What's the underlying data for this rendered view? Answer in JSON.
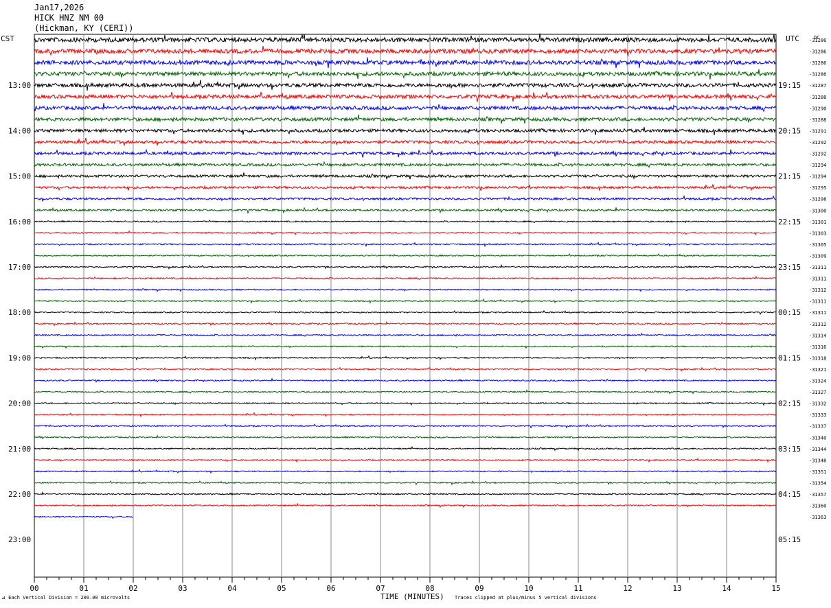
{
  "header": {
    "date": "Jan17,2026",
    "station": "HICK HNZ NM 00",
    "location": "(Hickman, KY (CERI))"
  },
  "left_tz": "CST",
  "right_tz": "UTC",
  "dc_label": "DC",
  "chart_data": {
    "type": "line",
    "title": "HICK HNZ NM 00",
    "xlabel": "TIME (MINUTES)",
    "x_ticks": [
      "00",
      "01",
      "02",
      "03",
      "04",
      "05",
      "06",
      "07",
      "08",
      "09",
      "10",
      "11",
      "12",
      "13",
      "14",
      "15"
    ],
    "xlim": [
      0,
      15
    ],
    "hour_labels_left": [
      "13:00",
      "14:00",
      "15:00",
      "16:00",
      "17:00",
      "18:00",
      "19:00",
      "20:00",
      "21:00",
      "22:00",
      "23:00"
    ],
    "hour_labels_right": [
      "19:15",
      "20:15",
      "21:15",
      "22:15",
      "23:15",
      "00:15",
      "01:15",
      "02:15",
      "03:15",
      "04:15",
      "05:15"
    ],
    "trace_colors": [
      "#000000",
      "#ff0000",
      "#0000ff",
      "#006400"
    ],
    "dc_offsets": [
      "-31286",
      "-31286",
      "-31286",
      "-31286",
      "-31287",
      "-31288",
      "-31290",
      "-31288",
      "-31291",
      "-31292",
      "-31292",
      "-31294",
      "-31294",
      "-31295",
      "-31298",
      "-31300",
      "-31301",
      "-31303",
      "-31305",
      "-31309",
      "-31311",
      "-31311",
      "-31312",
      "-31311",
      "-31311",
      "-31312",
      "-31314",
      "-31316",
      "-31318",
      "-31321",
      "-31324",
      "-31327",
      "-31332",
      "-31333",
      "-31337",
      "-31340",
      "-31344",
      "-31348",
      "-31351",
      "-31354",
      "-31357",
      "-31360",
      "-31363"
    ],
    "last_trace_end_minute": 2,
    "scale_note": "Each Vertical Division =  200.00 microvolts",
    "clip_note": "Traces clipped at plus/minus 5 vertical divisions"
  }
}
